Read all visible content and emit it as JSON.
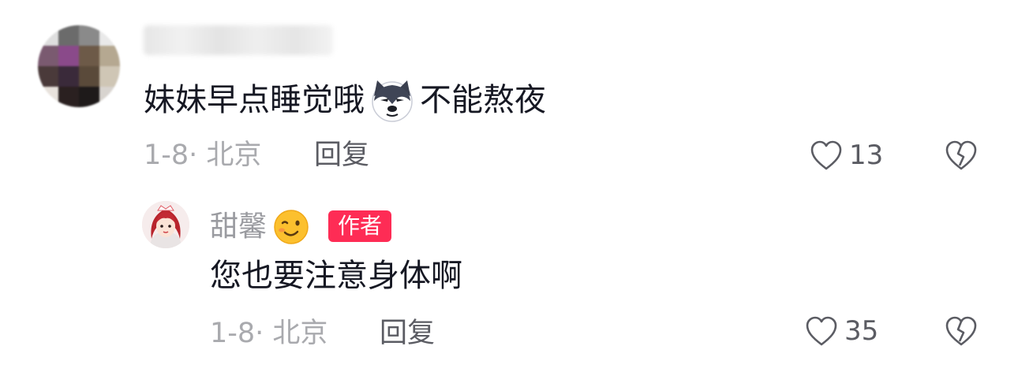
{
  "comments": [
    {
      "avatar_icon": "blurred-avatar",
      "text_before": "妹妹早点睡觉哦",
      "emoji": "husky-dog-emoji",
      "text_after": "不能熬夜",
      "date_location": "1-8· 北京",
      "reply_label": "回复",
      "like_count": "13"
    }
  ],
  "reply": {
    "avatar_icon": "cartoon-girl-avatar",
    "nickname": "甜馨",
    "nickname_emoji": "wink-face-emoji",
    "badge": "作者",
    "text": "您也要注意身体啊",
    "date_location": "1-8· 北京",
    "reply_label": "回复",
    "like_count": "35"
  },
  "colors": {
    "text_primary": "#161823",
    "text_meta": "#a9aaae",
    "badge_bg": "#fe2c55"
  }
}
